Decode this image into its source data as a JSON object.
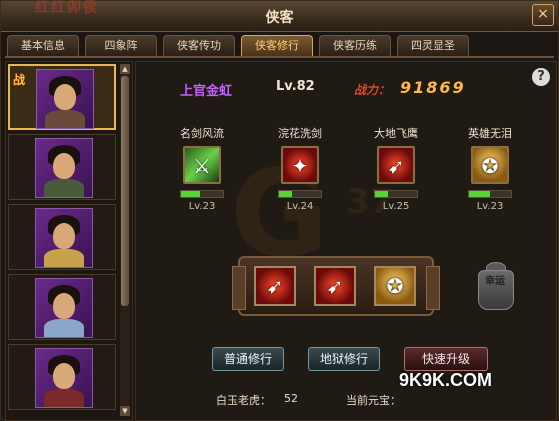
{
  "window": {
    "title": "侠客",
    "watermark": "红红卯侯",
    "close_label": "×"
  },
  "tabs": [
    {
      "label": "基本信息",
      "active": false
    },
    {
      "label": "四象阵",
      "active": false
    },
    {
      "label": "侠客传功",
      "active": false
    },
    {
      "label": "侠客修行",
      "active": true
    },
    {
      "label": "侠客历练",
      "active": false
    },
    {
      "label": "四灵显圣",
      "active": false
    }
  ],
  "hero_list": {
    "selected_badge": "战",
    "scroll_up": "▲",
    "scroll_down": "▼"
  },
  "hero": {
    "name": "上官金虹",
    "level": "Lv.82",
    "power_label": "战力：",
    "power_value": "91869"
  },
  "help_label": "?",
  "background_logo": {
    "main": "G",
    "sub": "37"
  },
  "skills": [
    {
      "name": "名剑风流",
      "level": "Lv.23",
      "icon": "sword-slash-icon",
      "color": "green",
      "progress": 0.45
    },
    {
      "name": "浣花洗剑",
      "level": "Lv.24",
      "icon": "sword-burst-icon",
      "color": "red",
      "progress": 0.3
    },
    {
      "name": "大地飞鹰",
      "level": "Lv.25",
      "icon": "flying-kick-icon",
      "color": "red",
      "progress": 0.3
    },
    {
      "name": "英雄无泪",
      "level": "Lv.23",
      "icon": "hero-power-icon",
      "color": "gold",
      "progress": 0.5
    }
  ],
  "altar_slots": [
    {
      "icon": "flying-kick-icon",
      "color": "red"
    },
    {
      "icon": "flying-kick-icon",
      "color": "red"
    },
    {
      "icon": "hero-power-icon",
      "color": "gold"
    }
  ],
  "lucky_bag": {
    "label": "幸运"
  },
  "buttons": {
    "normal_train": "普通修行",
    "hell_train": "地狱修行",
    "quick_upgrade": "快速升级"
  },
  "footer": {
    "jade_tiger_label": "白玉老虎：",
    "jade_tiger_value": "52",
    "ingot_label": "当前元宝："
  },
  "site_watermark": "9K9K.COM"
}
